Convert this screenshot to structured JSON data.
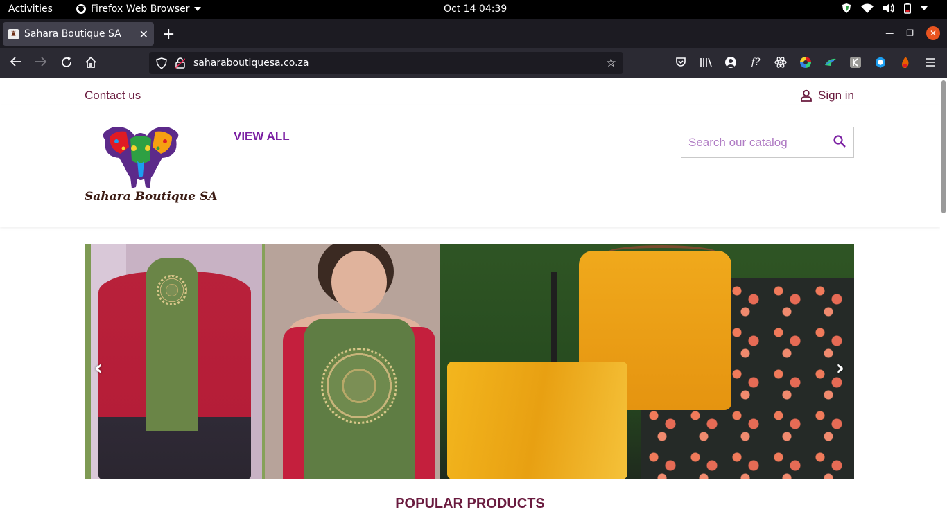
{
  "system": {
    "activities": "Activities",
    "app_name": "Firefox Web Browser",
    "clock": "Oct 14  04:39"
  },
  "browser": {
    "tab_title": "Sahara Boutique SA",
    "url": "saharaboutiquesa.co.za"
  },
  "site": {
    "contact_label": "Contact us",
    "signin_label": "Sign in",
    "brand_name": "Sahara Boutique SA",
    "nav_view_all": "VIEW ALL",
    "search_placeholder": "Search our catalog",
    "popular_heading": "POPULAR PRODUCTS",
    "accent_color": "#6a1b3f",
    "nav_color": "#7a1fa2"
  },
  "slider": {
    "prev_label": "‹",
    "next_label": "›"
  }
}
